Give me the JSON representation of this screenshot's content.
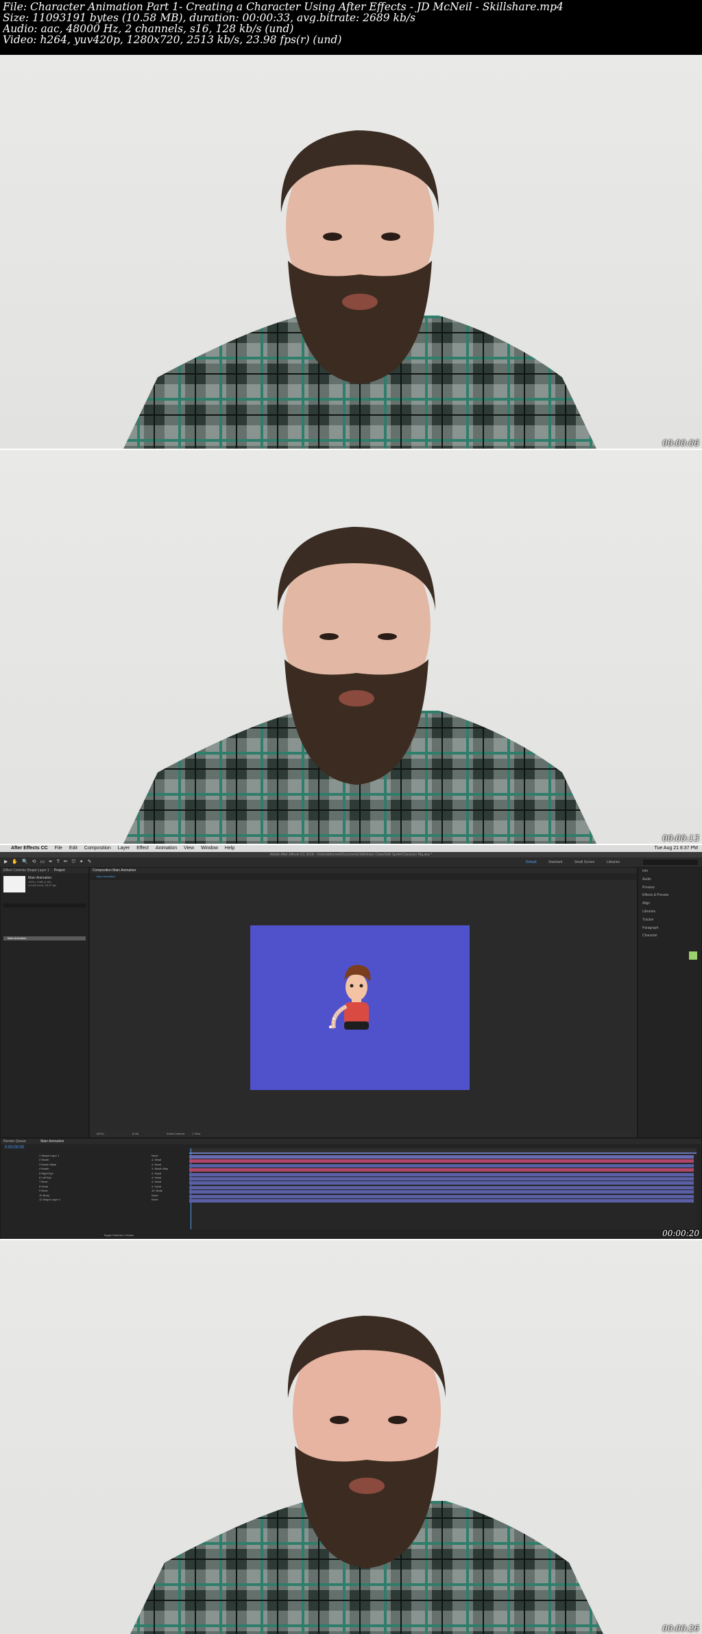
{
  "header": {
    "file": "File: Character Animation Part 1- Creating a Character Using After Effects - JD McNeil - Skillshare.mp4",
    "size": "Size: 11093191 bytes (10.58 MB), duration: 00:00:33, avg.bitrate: 2689 kb/s",
    "audio": "Audio: aac, 48000 Hz, 2 channels, s16, 128 kb/s (und)",
    "video": "Video: h264, yuv420p, 1280x720, 2513 kb/s, 23.98 fps(r) (und)"
  },
  "frames": [
    {
      "timestamp": "00:00:06"
    },
    {
      "timestamp": "00:00:13"
    },
    {
      "timestamp": "00:00:20"
    },
    {
      "timestamp": "00:00:26"
    }
  ],
  "ae": {
    "app_menu": [
      "After Effects CC",
      "File",
      "Edit",
      "Composition",
      "Layer",
      "Effect",
      "Animation",
      "View",
      "Window",
      "Help"
    ],
    "clock": "Tue Aug 21  8:37 PM",
    "window_title": "Adobe After Effects CC 2018 - /Users/jdmcneil/Documents/Skillshare Class/Skill Sprite/Character Rig.aep *",
    "tools": "▶ ✋ 🔍 ⟲ ▭ ✒ T ✏ ⛉ ✦ ✎",
    "workspaces": [
      "Default",
      "Standard",
      "Small Screen",
      "Libraries"
    ],
    "left_tabs": [
      "Effect Controls Shape Layer 1",
      "Project"
    ],
    "project_item": "Main Animation",
    "project_info": "1920 x 1080 (1.00)\nΔ 0;00;10;00, 29.97 fps",
    "comp_tab": "Composition Main Animation",
    "comp_subtab": "Main Animation",
    "viewer_zoom": "(50%)",
    "viewer_quality": "(Full)",
    "viewer_camera": "Active Camera",
    "viewer_views": "1 View",
    "right_panel": [
      "Info",
      "Audio",
      "Preview",
      "Effects & Presets",
      "Align",
      "Libraries",
      "Tracker",
      "Paragraph",
      "Character"
    ],
    "timeline_tabs": [
      "Render Queue",
      "Main Animation"
    ],
    "timecode": "0;00;00;00",
    "layers": [
      {
        "num": "1",
        "name": "Shape Layer 1",
        "parent": "None"
      },
      {
        "num": "2",
        "name": "Mouth",
        "parent": "4. Head"
      },
      {
        "num": "3",
        "name": "Mouth Mask",
        "parent": "4. Head"
      },
      {
        "num": "4",
        "name": "Mouth",
        "parent": "3. Mouth Mas"
      },
      {
        "num": "5",
        "name": "Right Eye",
        "parent": "4. Head"
      },
      {
        "num": "6",
        "name": "Left Eye",
        "parent": "4. Head"
      },
      {
        "num": "7",
        "name": "Brow",
        "parent": "4. Head"
      },
      {
        "num": "8",
        "name": "Head",
        "parent": "4. Head"
      },
      {
        "num": "9",
        "name": "Neck",
        "parent": "10. Body"
      },
      {
        "num": "10",
        "name": "Body",
        "parent": "None"
      },
      {
        "num": "11",
        "name": "Shape Layer 1",
        "parent": "None"
      }
    ],
    "timeline_footer": "Toggle Switches / Modes",
    "colors": {
      "comp_bg": "#5052cc",
      "ui_bg": "#232323",
      "accent": "#4f9cf4"
    }
  }
}
